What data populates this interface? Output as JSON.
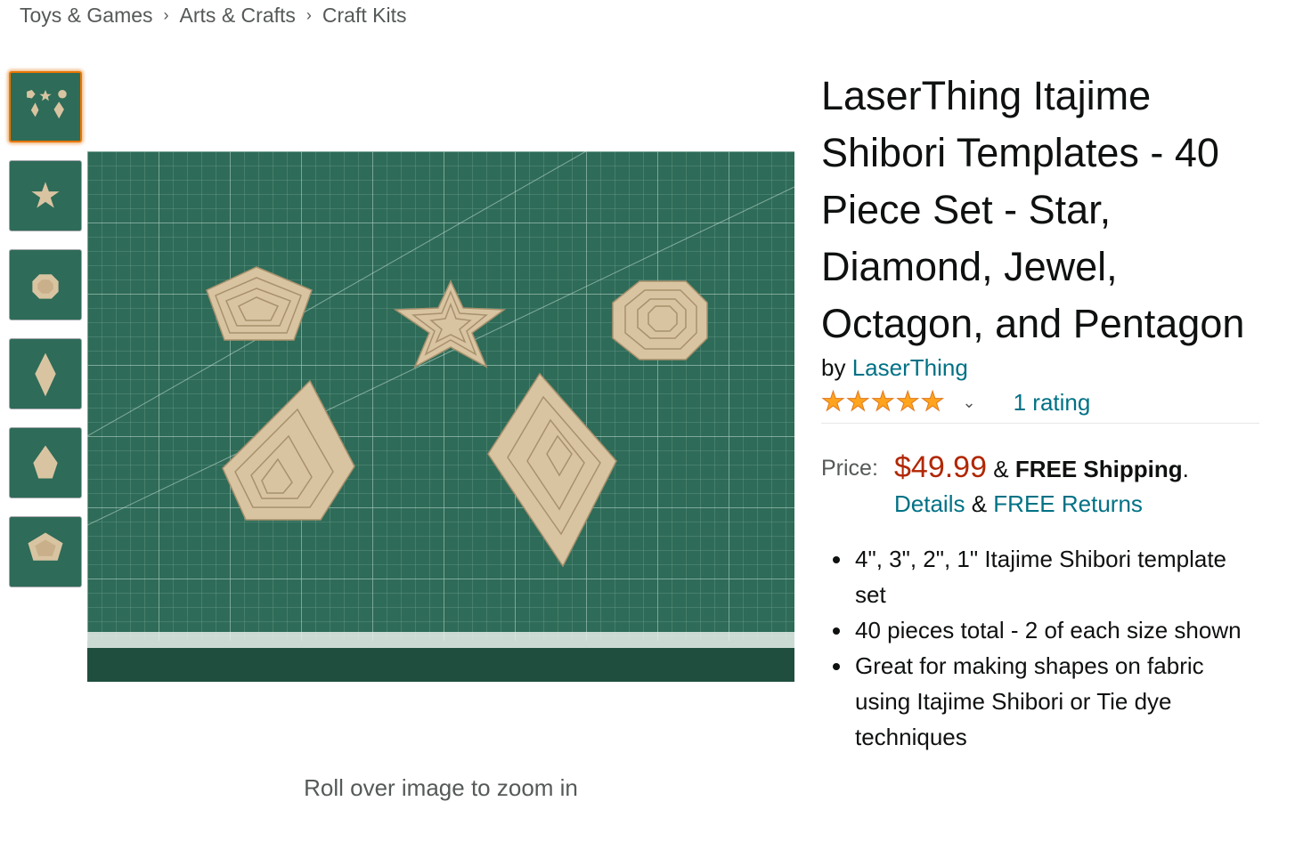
{
  "breadcrumb": {
    "items": [
      "Toys & Games",
      "Arts & Crafts",
      "Craft Kits"
    ],
    "separator": "›"
  },
  "gallery": {
    "thumbnails": [
      "four-shapes-view",
      "star-view",
      "octagon-view",
      "diamond-view",
      "jewel-view",
      "pentagon-view"
    ],
    "selected_index": 0,
    "zoom_hint": "Roll over image to zoom in"
  },
  "product": {
    "title": "LaserThing Itajime Shibori Templates - 40 Piece Set - Star, Diamond, Jewel, Octagon, and Pentagon",
    "by_prefix": "by",
    "brand": "LaserThing",
    "stars": 5,
    "rating_count": "1 rating",
    "price_label": "Price:",
    "price": "$49.99",
    "amp": "&",
    "shipping": "FREE Shipping",
    "period": ".",
    "details_link": "Details",
    "returns_link": "FREE Returns",
    "bullets": [
      "4\", 3\", 2\", 1\" Itajime Shibori template set",
      "40 pieces total - 2 of each size shown",
      "Great for making shapes on fabric using Itajime Shibori or Tie dye techniques"
    ]
  },
  "colors": {
    "mat_green": "#2e6b58",
    "wood": "#d9c4a2",
    "price": "#b12704",
    "link": "#007185",
    "selected_border": "#e77600",
    "star": "#ffa41c"
  }
}
